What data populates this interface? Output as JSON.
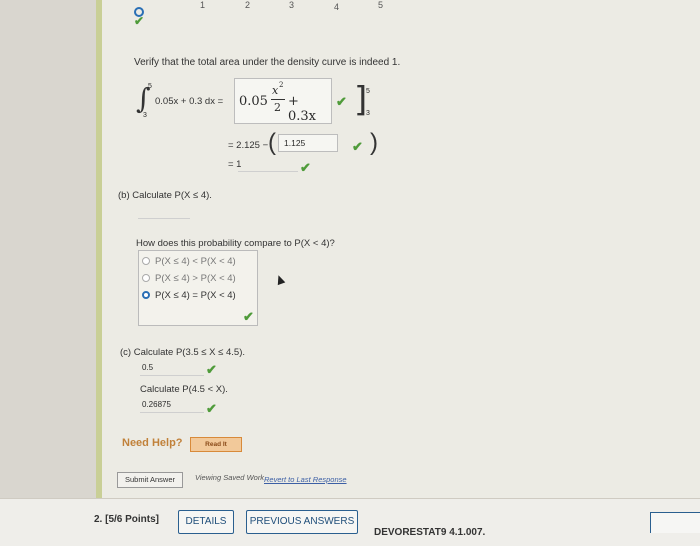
{
  "axis": {
    "ticks": [
      "1",
      "2",
      "3",
      "4",
      "5"
    ]
  },
  "question": {
    "verify_text": "Verify that the total area under the density curve is indeed 1.",
    "integral": {
      "upper": "5",
      "lower": "3",
      "integrand": "0.05x + 0.3 dx =",
      "antideriv_coef": "0.05",
      "antideriv_num": "x",
      "antideriv_exp": "2",
      "antideriv_den": "2",
      "antideriv_tail": "+ 0.3x",
      "eval_upper": "5",
      "eval_lower": "3",
      "line2_prefix": "= 2.125 −",
      "line2_value": "1.125",
      "line3_prefix": "= 1"
    },
    "part_b_label": "(b)  Calculate P(X ≤ 4).",
    "compare_text": "How does this probability compare to P(X < 4)?",
    "options": [
      "P(X ≤ 4) < P(X < 4)",
      "P(X ≤ 4) > P(X < 4)",
      "P(X ≤ 4) = P(X < 4)"
    ],
    "part_c_label": "(c)  Calculate P(3.5 ≤ X ≤ 4.5).",
    "part_c_answer": "0.5",
    "part_c2_label": "Calculate P(4.5 < X).",
    "part_c2_answer": "0.26875",
    "need_help": "Need Help?",
    "read_it": "Read It",
    "submit": "Submit Answer",
    "viewing_saved": "Viewing Saved Work",
    "revert": "Revert to Last Response"
  },
  "footer": {
    "points": "2.  [5/6 Points]",
    "details": "DETAILS",
    "previous": "PREVIOUS ANSWERS",
    "code": "DEVORESTAT9 4.1.007."
  }
}
